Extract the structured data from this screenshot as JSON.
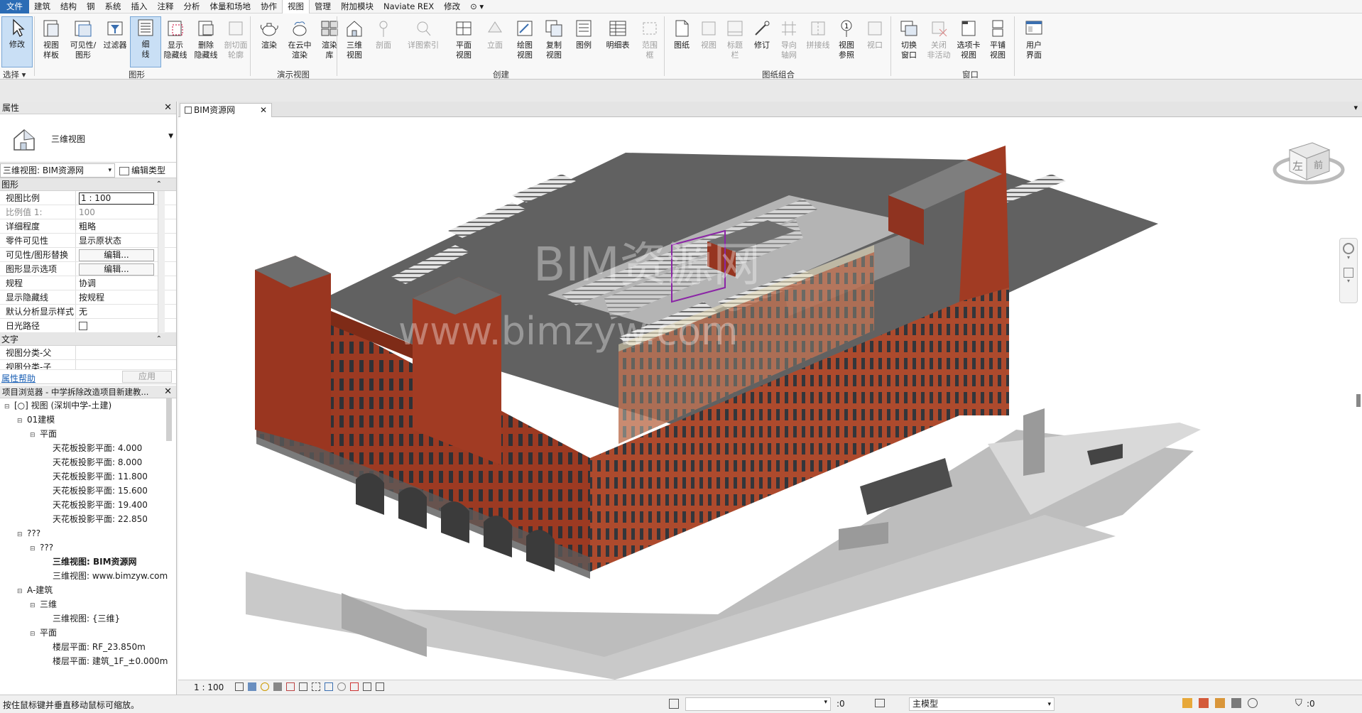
{
  "menu": {
    "file": "文件",
    "items": [
      "建筑",
      "结构",
      "钢",
      "系统",
      "插入",
      "注释",
      "分析",
      "体量和场地",
      "协作",
      "视图",
      "管理",
      "附加模块",
      "Naviate REX",
      "修改"
    ],
    "active_index": 9,
    "extra": "⊙ ▾"
  },
  "ribbon": {
    "tools": [
      {
        "label": "修改",
        "icon": "cursor-icon"
      },
      {
        "label": "视图\n样板",
        "icon": "view-template-icon"
      },
      {
        "label": "可见性/\n图形",
        "icon": "visibility-icon"
      },
      {
        "label": "过滤器",
        "icon": "filter-icon"
      },
      {
        "label": "细\n线",
        "icon": "thin-lines-icon"
      },
      {
        "label": "显示\n隐藏线",
        "icon": "show-hidden-icon"
      },
      {
        "label": "删除\n隐藏线",
        "icon": "remove-hidden-icon"
      },
      {
        "label": "剖切面\n轮廓",
        "icon": "cut-profile-icon"
      },
      {
        "label": "渲染",
        "icon": "render-teapot-icon"
      },
      {
        "label": "在云中\n渲染",
        "icon": "cloud-render-icon"
      },
      {
        "label": "渲染\n库",
        "icon": "render-gallery-icon"
      },
      {
        "label": "三维\n视图",
        "icon": "house-3d-icon"
      },
      {
        "label": "剖面",
        "icon": "section-icon"
      },
      {
        "label": "详图索引",
        "icon": "callout-icon"
      },
      {
        "label": "平面\n视图",
        "icon": "plan-view-icon"
      },
      {
        "label": "立面",
        "icon": "elevation-icon"
      },
      {
        "label": "绘图\n视图",
        "icon": "drafting-view-icon"
      },
      {
        "label": "复制\n视图",
        "icon": "duplicate-view-icon"
      },
      {
        "label": "图例",
        "icon": "legend-icon"
      },
      {
        "label": "明细表",
        "icon": "schedule-icon"
      },
      {
        "label": "范围\n框",
        "icon": "scope-box-icon"
      },
      {
        "label": "图纸",
        "icon": "sheet-icon"
      },
      {
        "label": "视图",
        "icon": "place-view-icon"
      },
      {
        "label": "标题\n栏",
        "icon": "title-block-icon"
      },
      {
        "label": "修订",
        "icon": "revision-icon"
      },
      {
        "label": "导向\n轴网",
        "icon": "guide-grid-icon"
      },
      {
        "label": "拼接线",
        "icon": "matchline-icon"
      },
      {
        "label": "视图\n参照",
        "icon": "view-reference-icon"
      },
      {
        "label": "视口",
        "icon": "viewport-icon"
      },
      {
        "label": "切换\n窗口",
        "icon": "switch-window-icon"
      },
      {
        "label": "关闭\n非活动",
        "icon": "close-inactive-icon"
      },
      {
        "label": "选项卡\n视图",
        "icon": "tab-views-icon"
      },
      {
        "label": "平铺\n视图",
        "icon": "tile-views-icon"
      },
      {
        "label": "用户\n界面",
        "icon": "user-interface-icon"
      }
    ],
    "panels": [
      "选择 ▾",
      "图形",
      "演示视图",
      "创建",
      "图纸组合",
      "窗口"
    ]
  },
  "properties": {
    "title": "属性",
    "type_name": "三维视图",
    "selector": "三维视图: BIM资源网",
    "edit_type": "编辑类型",
    "group_graphics": "图形",
    "rows": [
      {
        "k": "视图比例",
        "v": "1 : 100"
      },
      {
        "k": "比例值 1:",
        "v": "100"
      },
      {
        "k": "详细程度",
        "v": "粗略"
      },
      {
        "k": "零件可见性",
        "v": "显示原状态"
      },
      {
        "k": "可见性/图形替换",
        "v": "编辑..."
      },
      {
        "k": "图形显示选项",
        "v": "编辑..."
      },
      {
        "k": "规程",
        "v": "协调"
      },
      {
        "k": "显示隐藏线",
        "v": "按规程"
      },
      {
        "k": "默认分析显示样式",
        "v": "无"
      },
      {
        "k": "日光路径",
        "v": ""
      }
    ],
    "group_text": "文字",
    "text_rows": [
      {
        "k": "视图分类-父",
        "v": ""
      },
      {
        "k": "视图分类-子",
        "v": ""
      }
    ],
    "help": "属性帮助",
    "apply": "应用"
  },
  "browser": {
    "title": "项目浏览器 - 中学拆除改造项目新建教...",
    "items": [
      {
        "level": 0,
        "exp": "⊟",
        "text": "[○] 视图 (深圳中学-土建)",
        "bold": false
      },
      {
        "level": 1,
        "exp": "⊟",
        "text": "01建模",
        "bold": false
      },
      {
        "level": 2,
        "exp": "⊟",
        "text": "平面",
        "bold": false
      },
      {
        "level": 3,
        "exp": "",
        "text": "天花板投影平面: 4.000",
        "bold": false
      },
      {
        "level": 3,
        "exp": "",
        "text": "天花板投影平面: 8.000",
        "bold": false
      },
      {
        "level": 3,
        "exp": "",
        "text": "天花板投影平面: 11.800",
        "bold": false
      },
      {
        "level": 3,
        "exp": "",
        "text": "天花板投影平面: 15.600",
        "bold": false
      },
      {
        "level": 3,
        "exp": "",
        "text": "天花板投影平面: 19.400",
        "bold": false
      },
      {
        "level": 3,
        "exp": "",
        "text": "天花板投影平面: 22.850",
        "bold": false
      },
      {
        "level": 1,
        "exp": "⊟",
        "text": "???",
        "bold": false
      },
      {
        "level": 2,
        "exp": "⊟",
        "text": "???",
        "bold": false
      },
      {
        "level": 3,
        "exp": "",
        "text": "三维视图: BIM资源网",
        "bold": true
      },
      {
        "level": 3,
        "exp": "",
        "text": "三维视图: www.bimzyw.com",
        "bold": false
      },
      {
        "level": 1,
        "exp": "⊟",
        "text": "A-建筑",
        "bold": false
      },
      {
        "level": 2,
        "exp": "⊟",
        "text": "三维",
        "bold": false
      },
      {
        "level": 3,
        "exp": "",
        "text": "三维视图: {三维}",
        "bold": false
      },
      {
        "level": 2,
        "exp": "⊟",
        "text": "平面",
        "bold": false
      },
      {
        "level": 3,
        "exp": "",
        "text": "楼层平面: RF_23.850m",
        "bold": false
      },
      {
        "level": 3,
        "exp": "",
        "text": "楼层平面: 建筑_1F_±0.000m",
        "bold": false
      }
    ]
  },
  "document_tab": {
    "label": "BIM资源网"
  },
  "viewcube": {
    "left": "左",
    "front": "前"
  },
  "watermark": {
    "line1": "BIM资源网",
    "line2": "www.bimzyw.com"
  },
  "viewbar": {
    "scale": "1 : 100"
  },
  "status": {
    "message": "按住鼠标键并垂直移动鼠标可缩放。",
    "sel_count": ":0",
    "model": "主模型",
    "filter_count": ":0"
  },
  "colors": {
    "facade": "#b0442a",
    "roof": "#5f5f5f",
    "accent": "#2b6cb5"
  }
}
